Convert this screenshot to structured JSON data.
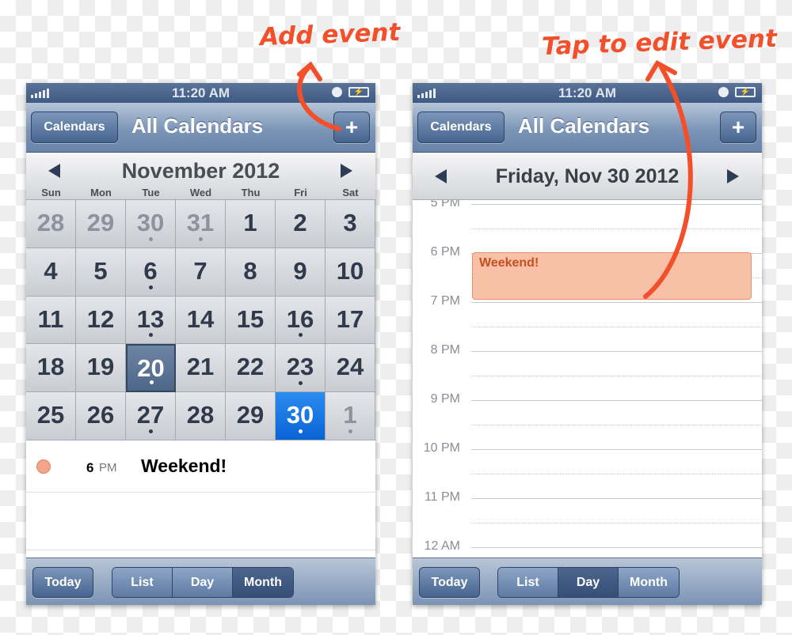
{
  "annotations": {
    "add_event": "Add event",
    "tap_to_edit": "Tap to edit event",
    "color": "#f1502b"
  },
  "left": {
    "status": {
      "time": "11:20 AM"
    },
    "nav": {
      "calendars_button": "Calendars",
      "title": "All Calendars",
      "add_button": "+"
    },
    "month_title": "November 2012",
    "weekdays": [
      "Sun",
      "Mon",
      "Tue",
      "Wed",
      "Thu",
      "Fri",
      "Sat"
    ],
    "days": [
      {
        "d": "28",
        "out": true
      },
      {
        "d": "29",
        "out": true
      },
      {
        "d": "30",
        "out": true,
        "dot": true
      },
      {
        "d": "31",
        "out": true,
        "dot": true
      },
      {
        "d": "1"
      },
      {
        "d": "2"
      },
      {
        "d": "3"
      },
      {
        "d": "4"
      },
      {
        "d": "5"
      },
      {
        "d": "6",
        "dot": true
      },
      {
        "d": "7"
      },
      {
        "d": "8"
      },
      {
        "d": "9"
      },
      {
        "d": "10"
      },
      {
        "d": "11"
      },
      {
        "d": "12"
      },
      {
        "d": "13",
        "dot": true
      },
      {
        "d": "14"
      },
      {
        "d": "15"
      },
      {
        "d": "16",
        "dot": true
      },
      {
        "d": "17"
      },
      {
        "d": "18"
      },
      {
        "d": "19"
      },
      {
        "d": "20",
        "dot": true,
        "selected": true
      },
      {
        "d": "21"
      },
      {
        "d": "22"
      },
      {
        "d": "23",
        "dot": true
      },
      {
        "d": "24"
      },
      {
        "d": "25"
      },
      {
        "d": "26"
      },
      {
        "d": "27",
        "dot": true
      },
      {
        "d": "28"
      },
      {
        "d": "29"
      },
      {
        "d": "30",
        "dot": true,
        "today": true
      },
      {
        "d": "1",
        "out": true,
        "dot": true
      }
    ],
    "event": {
      "hour": "6",
      "ampm": "PM",
      "title": "Weekend!",
      "color": "#f4a58a"
    },
    "toolbar": {
      "today": "Today",
      "views": [
        "List",
        "Day",
        "Month"
      ],
      "active": "Month"
    }
  },
  "right": {
    "status": {
      "time": "11:20 AM"
    },
    "nav": {
      "calendars_button": "Calendars",
      "title": "All Calendars",
      "add_button": "+"
    },
    "day_title": "Friday, Nov 30 2012",
    "hours": [
      "5 PM",
      "6 PM",
      "7 PM",
      "8 PM",
      "9 PM",
      "10 PM",
      "11 PM",
      "12 AM"
    ],
    "event": {
      "title": "Weekend!",
      "start": "6 PM",
      "end": "7 PM",
      "fill": "#f8c0a6",
      "text_color": "#c4501f"
    },
    "toolbar": {
      "today": "Today",
      "views": [
        "List",
        "Day",
        "Month"
      ],
      "active": "Day"
    }
  }
}
